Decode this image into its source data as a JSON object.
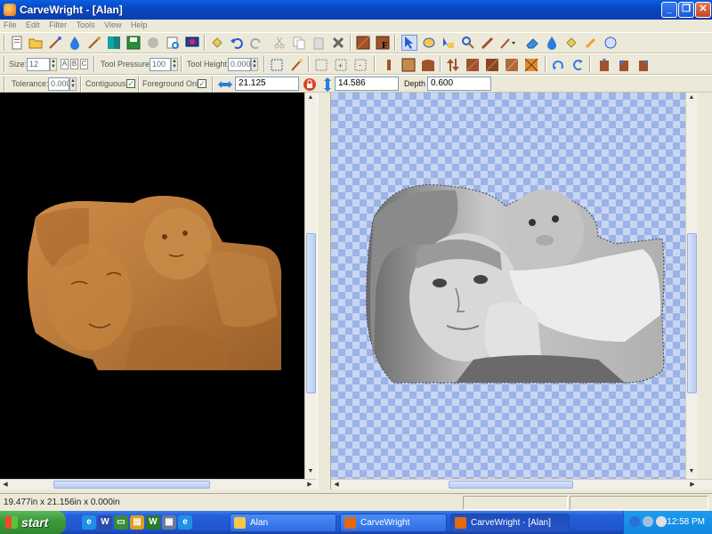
{
  "window": {
    "title": "CarveWright - [Alan]"
  },
  "menu": [
    "File",
    "Edit",
    "Filter",
    "Tools",
    "View",
    "Help"
  ],
  "toolbar2": {
    "size_label": "Size:",
    "size_value": "12",
    "abc": [
      "A",
      "B",
      "C"
    ],
    "pressure_label": "Tool Pressure:",
    "pressure_value": "100",
    "height_label": "Tool Height:",
    "height_value": "0.000"
  },
  "toolbar3": {
    "tolerance_label": "Tolerance:",
    "tolerance_value": "0.000",
    "contiguous_label": "Contiguous:",
    "contiguous_checked": "✓",
    "foreground_label": "Foreground Only:",
    "foreground_checked": "✓",
    "width_value": "21.125",
    "height_value": "14.586",
    "depth_label": "Depth",
    "depth_value": "0.600"
  },
  "status": {
    "text": "19.477in x 21.156in x 0.000in"
  },
  "taskbar": {
    "start": "start",
    "tasks": [
      "Alan",
      "CarveWright",
      "CarveWright - [Alan]"
    ],
    "clock": "12:58 PM"
  },
  "colors": {
    "carving": "#b8793a",
    "workspace_left": "#000000",
    "checker": "#9bb3e6"
  }
}
